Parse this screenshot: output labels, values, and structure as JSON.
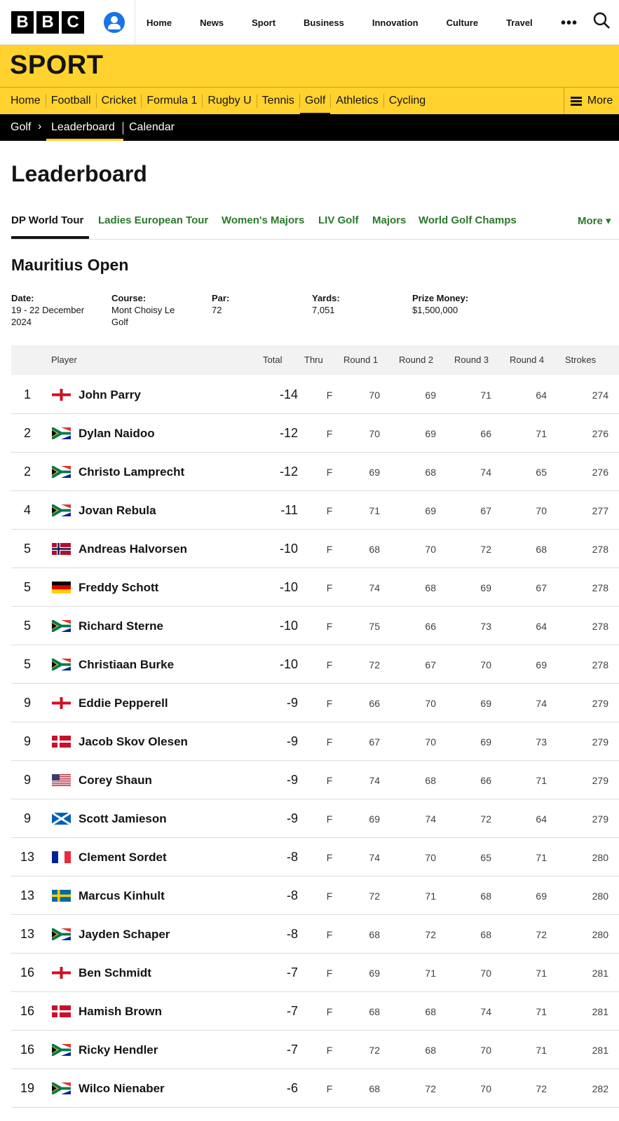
{
  "masthead": {
    "logo_letters": [
      "B",
      "B",
      "C"
    ],
    "nav": [
      "Home",
      "News",
      "Sport",
      "Business",
      "Innovation",
      "Culture",
      "Travel"
    ],
    "more_glyph": "•••"
  },
  "sport": {
    "title": "SPORT",
    "nav": [
      "Home",
      "Football",
      "Cricket",
      "Formula 1",
      "Rugby U",
      "Tennis",
      "Golf",
      "Athletics",
      "Cycling"
    ],
    "active_nav": "Golf",
    "more_label": "More"
  },
  "subnav": {
    "section": "Golf",
    "chevron": "›",
    "current": "Leaderboard",
    "other": "Calendar"
  },
  "page_title": "Leaderboard",
  "tours": {
    "items": [
      "DP World Tour",
      "Ladies European Tour",
      "Women's Majors",
      "LIV Golf",
      "Majors",
      "World Golf Champs"
    ],
    "active": "DP World Tour",
    "more_label": "More ▾"
  },
  "event": {
    "name": "Mauritius Open",
    "details": [
      {
        "label": "Date:",
        "value": "19 - 22 December 2024"
      },
      {
        "label": "Course:",
        "value": "Mont Choisy Le Golf"
      },
      {
        "label": "Par:",
        "value": "72"
      },
      {
        "label": "Yards:",
        "value": "7,051"
      },
      {
        "label": "Prize Money:",
        "value": "$1,500,000"
      }
    ]
  },
  "table": {
    "headers": {
      "player": "Player",
      "total": "Total",
      "thru": "Thru",
      "round1": "Round 1",
      "round2": "Round 2",
      "round3": "Round 3",
      "round4": "Round 4",
      "strokes": "Strokes"
    },
    "rows": [
      {
        "pos": "1",
        "flag": "england",
        "name": "John Parry",
        "total": "-14",
        "thru": "F",
        "r1": "70",
        "r2": "69",
        "r3": "71",
        "r4": "64",
        "strokes": "274"
      },
      {
        "pos": "2",
        "flag": "south-africa",
        "name": "Dylan Naidoo",
        "total": "-12",
        "thru": "F",
        "r1": "70",
        "r2": "69",
        "r3": "66",
        "r4": "71",
        "strokes": "276"
      },
      {
        "pos": "2",
        "flag": "south-africa",
        "name": "Christo Lamprecht",
        "total": "-12",
        "thru": "F",
        "r1": "69",
        "r2": "68",
        "r3": "74",
        "r4": "65",
        "strokes": "276"
      },
      {
        "pos": "4",
        "flag": "south-africa",
        "name": "Jovan Rebula",
        "total": "-11",
        "thru": "F",
        "r1": "71",
        "r2": "69",
        "r3": "67",
        "r4": "70",
        "strokes": "277"
      },
      {
        "pos": "5",
        "flag": "norway",
        "name": "Andreas Halvorsen",
        "total": "-10",
        "thru": "F",
        "r1": "68",
        "r2": "70",
        "r3": "72",
        "r4": "68",
        "strokes": "278"
      },
      {
        "pos": "5",
        "flag": "germany",
        "name": "Freddy Schott",
        "total": "-10",
        "thru": "F",
        "r1": "74",
        "r2": "68",
        "r3": "69",
        "r4": "67",
        "strokes": "278"
      },
      {
        "pos": "5",
        "flag": "south-africa",
        "name": "Richard Sterne",
        "total": "-10",
        "thru": "F",
        "r1": "75",
        "r2": "66",
        "r3": "73",
        "r4": "64",
        "strokes": "278"
      },
      {
        "pos": "5",
        "flag": "south-africa",
        "name": "Christiaan Burke",
        "total": "-10",
        "thru": "F",
        "r1": "72",
        "r2": "67",
        "r3": "70",
        "r4": "69",
        "strokes": "278"
      },
      {
        "pos": "9",
        "flag": "england",
        "name": "Eddie Pepperell",
        "total": "-9",
        "thru": "F",
        "r1": "66",
        "r2": "70",
        "r3": "69",
        "r4": "74",
        "strokes": "279"
      },
      {
        "pos": "9",
        "flag": "denmark",
        "name": "Jacob Skov Olesen",
        "total": "-9",
        "thru": "F",
        "r1": "67",
        "r2": "70",
        "r3": "69",
        "r4": "73",
        "strokes": "279"
      },
      {
        "pos": "9",
        "flag": "usa",
        "name": "Corey Shaun",
        "total": "-9",
        "thru": "F",
        "r1": "74",
        "r2": "68",
        "r3": "66",
        "r4": "71",
        "strokes": "279"
      },
      {
        "pos": "9",
        "flag": "scotland",
        "name": "Scott Jamieson",
        "total": "-9",
        "thru": "F",
        "r1": "69",
        "r2": "74",
        "r3": "72",
        "r4": "64",
        "strokes": "279"
      },
      {
        "pos": "13",
        "flag": "france",
        "name": "Clement Sordet",
        "total": "-8",
        "thru": "F",
        "r1": "74",
        "r2": "70",
        "r3": "65",
        "r4": "71",
        "strokes": "280"
      },
      {
        "pos": "13",
        "flag": "sweden",
        "name": "Marcus Kinhult",
        "total": "-8",
        "thru": "F",
        "r1": "72",
        "r2": "71",
        "r3": "68",
        "r4": "69",
        "strokes": "280"
      },
      {
        "pos": "13",
        "flag": "south-africa",
        "name": "Jayden Schaper",
        "total": "-8",
        "thru": "F",
        "r1": "68",
        "r2": "72",
        "r3": "68",
        "r4": "72",
        "strokes": "280"
      },
      {
        "pos": "16",
        "flag": "england",
        "name": "Ben Schmidt",
        "total": "-7",
        "thru": "F",
        "r1": "69",
        "r2": "71",
        "r3": "70",
        "r4": "71",
        "strokes": "281"
      },
      {
        "pos": "16",
        "flag": "denmark",
        "name": "Hamish Brown",
        "total": "-7",
        "thru": "F",
        "r1": "68",
        "r2": "68",
        "r3": "74",
        "r4": "71",
        "strokes": "281"
      },
      {
        "pos": "16",
        "flag": "south-africa",
        "name": "Ricky Hendler",
        "total": "-7",
        "thru": "F",
        "r1": "72",
        "r2": "68",
        "r3": "70",
        "r4": "71",
        "strokes": "281"
      },
      {
        "pos": "19",
        "flag": "south-africa",
        "name": "Wilco Nienaber",
        "total": "-6",
        "thru": "F",
        "r1": "68",
        "r2": "72",
        "r3": "70",
        "r4": "72",
        "strokes": "282"
      }
    ]
  },
  "colors": {
    "sport_yellow": "#ffd230",
    "tab_green": "#2a7a2a",
    "account_blue": "#1a73e8"
  }
}
